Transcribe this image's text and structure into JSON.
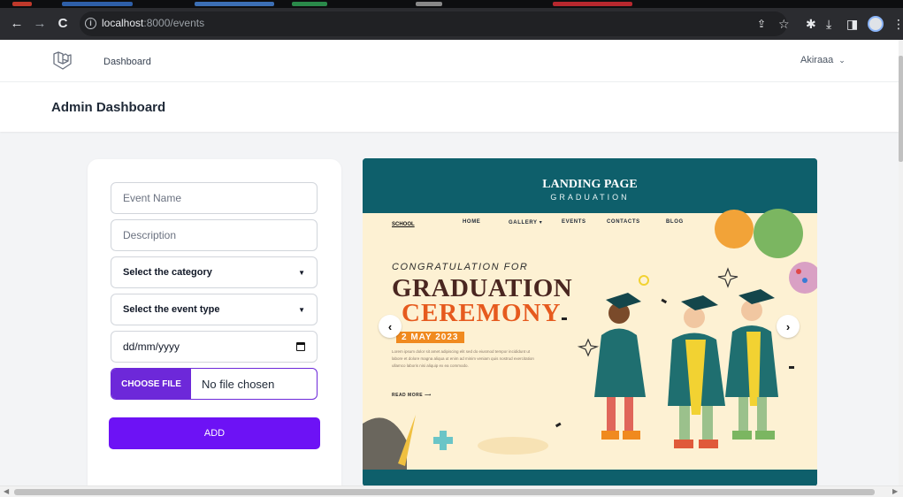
{
  "browser": {
    "url_host": "localhost",
    "url_path": ":8000/events"
  },
  "navbar": {
    "nav_link": "Dashboard",
    "user_name": "Akiraaa"
  },
  "header": {
    "title": "Admin Dashboard"
  },
  "form": {
    "event_name_placeholder": "Event Name",
    "description_placeholder": "Description",
    "category_select": "Select the category",
    "event_type_select": "Select the event type",
    "date_placeholder": "dd/mm/yyyy",
    "file_button": "CHOOSE FILE",
    "file_status": "No file chosen",
    "submit_label": "ADD"
  },
  "carousel": {
    "title": "LANDING PAGE",
    "subtitle": "GRADUATION",
    "school_label": "SCHOOL",
    "nav_items": [
      "HOME",
      "GALLERY ▾",
      "EVENTS",
      "CONTACTS",
      "BLOG"
    ],
    "congrats": "CONGRATULATION FOR",
    "headline_1": "GRADUATION",
    "headline_2": "CEREMONY",
    "date_tag": "2 MAY 2023",
    "body_text": "Lorem ipsum dolor sit amet adipiscing elit sed do eiusmod tempor incididunt ut labore et dolore magna aliqua ut enim ad minim veniam quis nostrud exercitation ullamco laboris nisi aliquip ex ea commodo.",
    "read_more": "READ MORE ⟶",
    "prev_label": "‹",
    "next_label": "›"
  },
  "colors": {
    "primary_purple": "#6d12f5",
    "file_purple": "#6d28d9",
    "carousel_teal": "#0e5f6b",
    "carousel_cream": "#fdf1d3"
  }
}
